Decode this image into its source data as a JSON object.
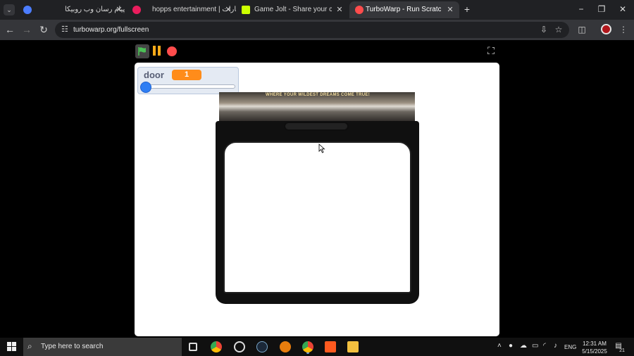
{
  "browser": {
    "tabs": [
      {
        "title": "پیام رسان وب روبیکا",
        "active": false
      },
      {
        "title": "hopps entertainment | آپارات",
        "active": false
      },
      {
        "title": "Game Jolt - Share your creations",
        "active": false
      },
      {
        "title": "TurboWarp - Run Scratch projects",
        "active": true
      }
    ],
    "url": "turbowarp.org/fullscreen"
  },
  "player": {
    "monitor": {
      "label": "door",
      "value": "1",
      "slider_fraction": 0.0
    },
    "sign_text": "WHERE YOUR WILDEST DREAMS COME TRUE!"
  },
  "taskbar": {
    "search_placeholder": "Type here to search",
    "language": "ENG",
    "time": "12:31 AM",
    "date": "5/15/2025",
    "notification_count": "21"
  },
  "colors": {
    "green_flag": "#4cbf56",
    "pause": "#ffab19",
    "stop": "#ff4c4c",
    "monitor_value": "#ff8c1a",
    "slider_thumb": "#2f7ef3"
  }
}
